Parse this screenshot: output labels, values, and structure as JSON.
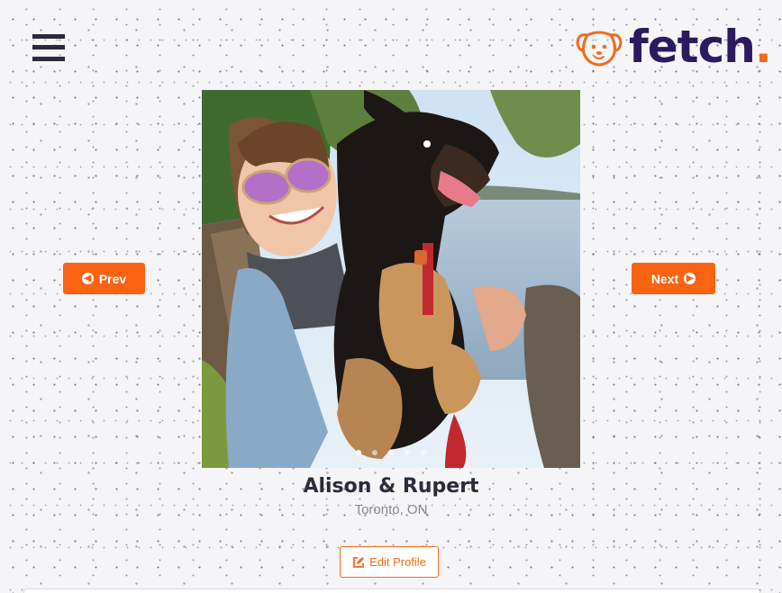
{
  "header": {
    "menu_icon": "hamburger-menu-icon",
    "logo_icon": "dog-face-icon",
    "logo_text": "fetch",
    "logo_dot": ".",
    "brand_color": "#2b1a5e",
    "accent_color": "#f26b1d"
  },
  "carousel": {
    "photo": "woman-with-dog-photo",
    "slide_count": 5,
    "active_slide": 1,
    "prev_label": "Prev",
    "next_label": "Next",
    "prev_icon": "arrow-circle-left-icon",
    "next_icon": "arrow-circle-right-icon",
    "button_color": "#fa6311"
  },
  "profile": {
    "name": "Alison & Rupert",
    "location": "Toronto, ON",
    "edit_label": "Edit Profile",
    "edit_icon": "edit-square-icon"
  }
}
